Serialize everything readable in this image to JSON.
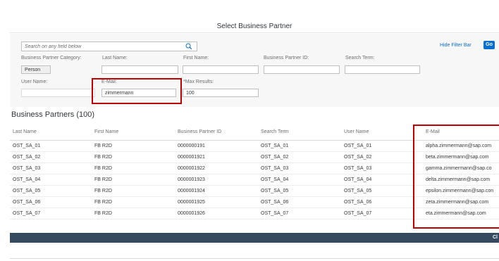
{
  "dialog": {
    "title": "Select Business Partner"
  },
  "filter_bar": {
    "search_placeholder": "Search on any field below",
    "hide_filter_label": "Hide Filter Bar",
    "go_label": "Go",
    "fields": {
      "category": {
        "label": "Business Partner Category:",
        "value": "Person"
      },
      "last_name": {
        "label": "Last Name:",
        "value": ""
      },
      "first_name": {
        "label": "First Name:",
        "value": ""
      },
      "bp_id": {
        "label": "Business Partner ID:",
        "value": ""
      },
      "search_term": {
        "label": "Search Term:",
        "value": ""
      },
      "user_name": {
        "label": "User Name:",
        "value": ""
      },
      "email": {
        "label": "E-Mail:",
        "value": "zimmermann"
      },
      "max_results": {
        "label": "*Max Results:",
        "value": "100"
      }
    }
  },
  "table": {
    "title": "Business Partners (100)",
    "columns": [
      "Last Name",
      "First Name",
      "Business Partner ID",
      "Search Term",
      "User Name",
      "E-Mail"
    ],
    "rows": [
      [
        "OST_SA_01",
        "FB R2D",
        "0000000191",
        "OST_SA_01",
        "OST_SA_01",
        "alpha.zimmermann@sap.com"
      ],
      [
        "OST_SA_02",
        "FB R2D",
        "0000001921",
        "OST_SA_02",
        "OST_SA_02",
        "beta.zimmermann@sap.com"
      ],
      [
        "OST_SA_03",
        "FB R2D",
        "0000001922",
        "OST_SA_03",
        "OST_SA_03",
        "gamma.zimmermann@sap.co"
      ],
      [
        "OST_SA_04",
        "FB R2D",
        "0000001923",
        "OST_SA_04",
        "OST_SA_04",
        "delta.zimmermann@sap.com"
      ],
      [
        "OST_SA_05",
        "FB R2D",
        "0000001924",
        "OST_SA_05",
        "OST_SA_05",
        "epsilon.zimmermann@sap.con"
      ],
      [
        "OST_SA_06",
        "FB R2D",
        "0000001925",
        "OST_SA_06",
        "OST_SA_06",
        "zeta.zimmermann@sap.com"
      ],
      [
        "OST_SA_07",
        "FB R2D",
        "0000001926",
        "OST_SA_07",
        "OST_SA_07",
        "eta.zimmermann@sap.com"
      ]
    ]
  },
  "footer": {
    "close_label": "Cl"
  },
  "colors": {
    "accent": "#0a6ed1",
    "highlight": "#c00000",
    "footer": "#354a5f"
  },
  "icons": {
    "search": "search-icon"
  }
}
